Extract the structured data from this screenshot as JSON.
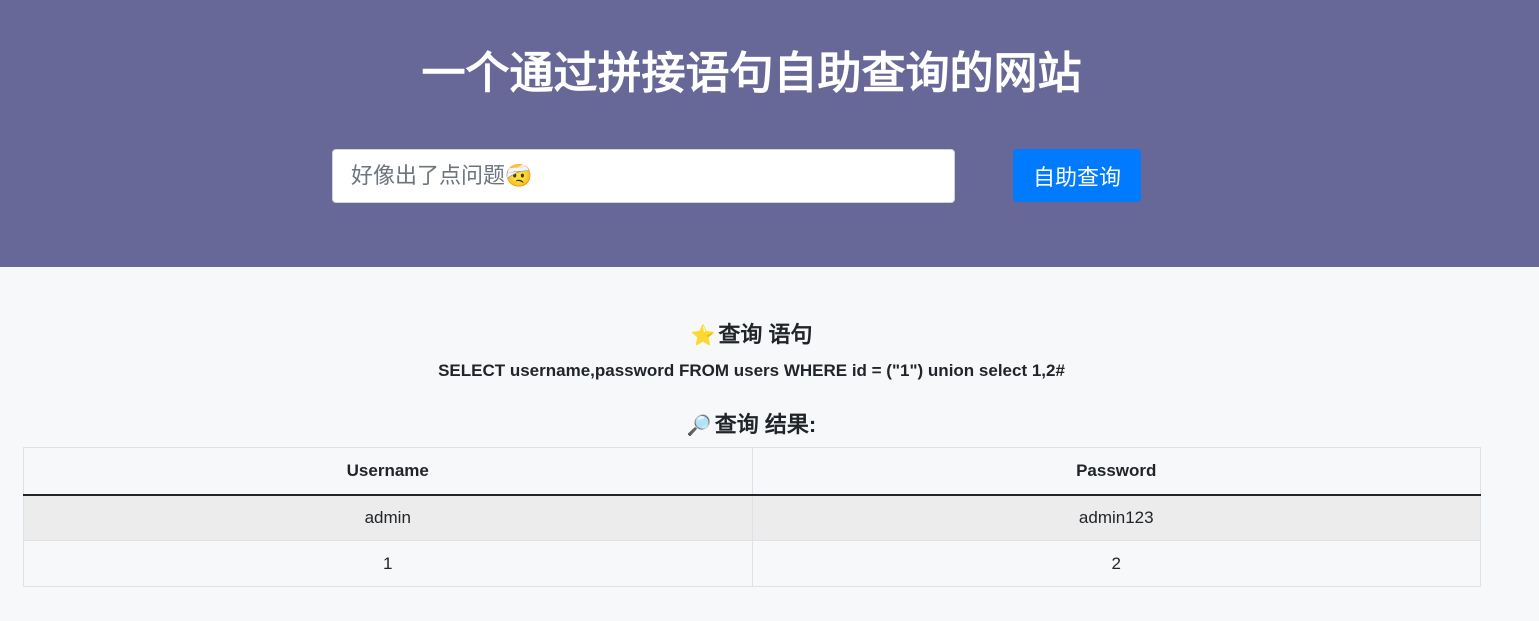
{
  "header": {
    "title": "一个通过拼接语句自助查询的网站",
    "search_placeholder": "好像出了点问题🤕",
    "search_value": "",
    "button_label": "自助查询"
  },
  "query_section": {
    "icon": "⭐",
    "icon_name": "star-icon",
    "heading": "查询 语句",
    "sql": "SELECT username,password FROM users WHERE id = (\"1\") union select 1,2#"
  },
  "result_section": {
    "icon": "🔎",
    "icon_name": "magnifier-icon",
    "heading": "查询 结果:",
    "columns": [
      "Username",
      "Password"
    ],
    "rows": [
      [
        "admin",
        "admin123"
      ],
      [
        "1",
        "2"
      ]
    ]
  },
  "colors": {
    "header_bg": "#676798",
    "button_bg": "#007bff",
    "page_bg": "#f7f8fa"
  }
}
